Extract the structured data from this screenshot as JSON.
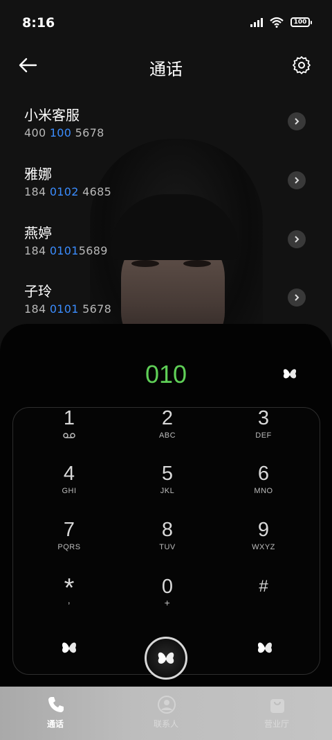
{
  "status_bar": {
    "time": "8:16",
    "battery": "100"
  },
  "header": {
    "title": "通话"
  },
  "contacts": [
    {
      "name": "小米客服",
      "num_pre": "400 ",
      "num_hl": "100",
      "num_post": " 5678"
    },
    {
      "name": "雅娜",
      "num_pre": "184 ",
      "num_hl": "0102",
      "num_post": " 4685"
    },
    {
      "name": "燕婷",
      "num_pre": "184 ",
      "num_hl": "0101",
      "num_post": "5689"
    },
    {
      "name": "子玲",
      "num_pre": "184 ",
      "num_hl": "0101",
      "num_post": " 5678"
    }
  ],
  "dialer": {
    "input": "010",
    "keys": [
      {
        "digit": "1",
        "letters": ""
      },
      {
        "digit": "2",
        "letters": "ABC"
      },
      {
        "digit": "3",
        "letters": "DEF"
      },
      {
        "digit": "4",
        "letters": "GHI"
      },
      {
        "digit": "5",
        "letters": "JKL"
      },
      {
        "digit": "6",
        "letters": "MNO"
      },
      {
        "digit": "7",
        "letters": "PQRS"
      },
      {
        "digit": "8",
        "letters": "TUV"
      },
      {
        "digit": "9",
        "letters": "WXYZ"
      },
      {
        "digit": "*",
        "letters": ","
      },
      {
        "digit": "0",
        "letters": "+"
      },
      {
        "digit": "#",
        "letters": ""
      }
    ]
  },
  "tabs": [
    {
      "label": "通话",
      "icon": "phone-icon",
      "active": true
    },
    {
      "label": "联系人",
      "icon": "person-icon",
      "active": false
    },
    {
      "label": "营业厅",
      "icon": "shopping-bag-icon",
      "active": false
    }
  ],
  "colors": {
    "accent_green": "#5fcf57",
    "highlight_blue": "#3b8dff"
  }
}
